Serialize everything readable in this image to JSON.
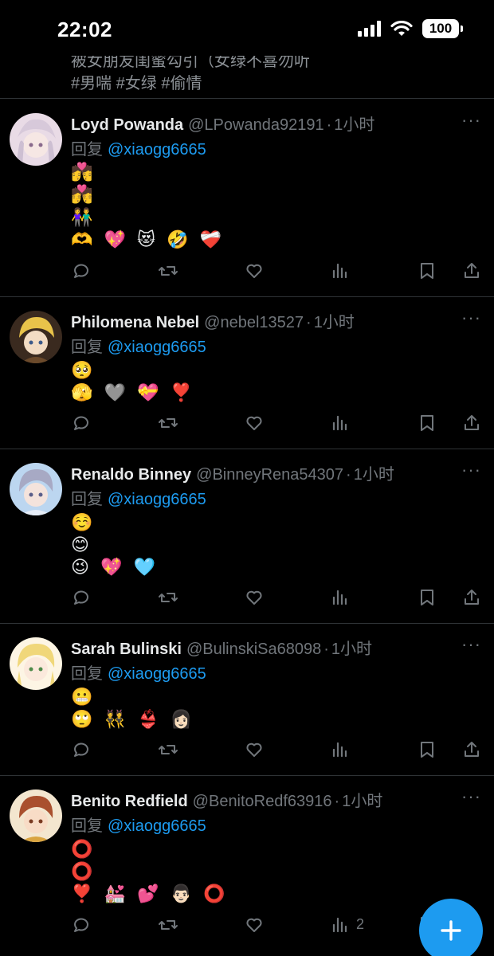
{
  "status_bar": {
    "time": "22:02",
    "battery": "100"
  },
  "top_fragment": {
    "line1": "被女朋友闺蜜勾引（女绿不喜勿听",
    "line2": "#男喘 #女绿 #偷情"
  },
  "reply_prefix": "回复",
  "more_label": "···",
  "tweets": [
    {
      "name": "Loyd Powanda",
      "handle": "@LPowanda92191",
      "time": "1小时",
      "mention": "@xiaogg6665",
      "emoji_lines": [
        "💏",
        "💏",
        "👫",
        "🫶 💖 😻 🤣 ❤️‍🩹"
      ],
      "analytics_count": ""
    },
    {
      "name": "Philomena Nebel",
      "handle": "@nebel13527",
      "time": "1小时",
      "mention": "@xiaogg6665",
      "emoji_lines": [
        "🥺",
        "🫣 🩶 💝 ❣️"
      ],
      "analytics_count": ""
    },
    {
      "name": "Renaldo Binney",
      "handle": "@BinneyRena54307",
      "time": "1小时",
      "mention": "@xiaogg6665",
      "emoji_lines": [
        "☺️",
        "😊",
        "😉 💖 🩵"
      ],
      "analytics_count": ""
    },
    {
      "name": "Sarah Bulinski",
      "handle": "@BulinskiSa68098",
      "time": "1小时",
      "mention": "@xiaogg6665",
      "emoji_lines": [
        "😬",
        "🙄 👯 👙 👩🏻"
      ],
      "analytics_count": ""
    },
    {
      "name": "Benito Redfield",
      "handle": "@BenitoRedf63916",
      "time": "1小时",
      "mention": "@xiaogg6665",
      "emoji_lines": [
        "⭕",
        "⭕",
        "❣️ 💒 💕 👨🏻 ⭕"
      ],
      "analytics_count": "2"
    }
  ],
  "colors": {
    "accent": "#1d9bf0",
    "background": "#000000",
    "muted": "#71767b",
    "divider": "#2f3336"
  },
  "icons": [
    "reply-icon",
    "retweet-icon",
    "like-icon",
    "analytics-icon",
    "bookmark-icon",
    "share-icon",
    "compose-icon"
  ]
}
